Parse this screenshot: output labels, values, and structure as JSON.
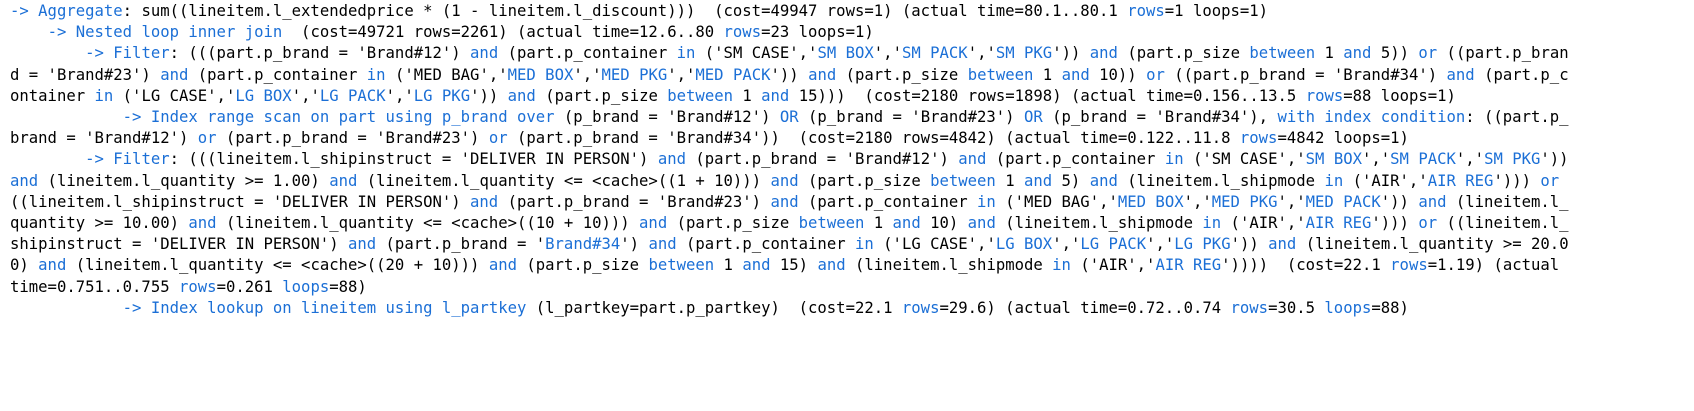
{
  "explain_output": {
    "colors": {
      "keyword": "#1b6fd6",
      "text": "#000000",
      "background": "#ffffff"
    },
    "lines": [
      {
        "indent": "",
        "segments": [
          {
            "t": "-> Aggregate",
            "k": 1
          },
          {
            "t": ": sum((lineitem.l_extendedprice * (1 - lineitem.l_discount)))  (cost=49947 rows=1) (actual time=80.1..80.1 ",
            "k": 0
          },
          {
            "t": "rows",
            "k": 1
          },
          {
            "t": "=1 loops=1)",
            "k": 0
          }
        ]
      },
      {
        "indent": "    ",
        "segments": [
          {
            "t": "-> Nested loop inner join",
            "k": 1
          },
          {
            "t": "  (cost=49721 rows=2261) (actual time=12.6..80 ",
            "k": 0
          },
          {
            "t": "rows",
            "k": 1
          },
          {
            "t": "=23 loops=1)",
            "k": 0
          }
        ]
      },
      {
        "indent": "        ",
        "segments": [
          {
            "t": "-> Filter",
            "k": 1
          },
          {
            "t": ": (((part.p_brand = 'Brand#12') ",
            "k": 0
          },
          {
            "t": "and",
            "k": 1
          },
          {
            "t": " (part.p_container ",
            "k": 0
          },
          {
            "t": "in",
            "k": 1
          },
          {
            "t": " ('SM CASE','",
            "k": 0
          },
          {
            "t": "SM BOX",
            "k": 1
          },
          {
            "t": "','",
            "k": 0
          },
          {
            "t": "SM PACK",
            "k": 1
          },
          {
            "t": "','",
            "k": 0
          },
          {
            "t": "SM PKG",
            "k": 1
          },
          {
            "t": "')) ",
            "k": 0
          },
          {
            "t": "and",
            "k": 1
          },
          {
            "t": " (part.p_size ",
            "k": 0
          },
          {
            "t": "between",
            "k": 1
          },
          {
            "t": " 1 ",
            "k": 0
          },
          {
            "t": "and",
            "k": 1
          },
          {
            "t": " 5)) ",
            "k": 0
          },
          {
            "t": "or",
            "k": 1
          },
          {
            "t": " ((part.p_brand = 'Brand#23') ",
            "k": 0
          },
          {
            "t": "and",
            "k": 1
          },
          {
            "t": " (part.p_container ",
            "k": 0
          },
          {
            "t": "in",
            "k": 1
          },
          {
            "t": " ('MED BAG','",
            "k": 0
          },
          {
            "t": "MED BOX",
            "k": 1
          },
          {
            "t": "','",
            "k": 0
          },
          {
            "t": "MED PKG",
            "k": 1
          },
          {
            "t": "','",
            "k": 0
          },
          {
            "t": "MED PACK",
            "k": 1
          },
          {
            "t": "')) ",
            "k": 0
          },
          {
            "t": "and",
            "k": 1
          },
          {
            "t": " (part.p_size ",
            "k": 0
          },
          {
            "t": "between",
            "k": 1
          },
          {
            "t": " 1 ",
            "k": 0
          },
          {
            "t": "and",
            "k": 1
          },
          {
            "t": " 10)) ",
            "k": 0
          },
          {
            "t": "or",
            "k": 1
          },
          {
            "t": " ((part.p_brand = 'Brand#34') ",
            "k": 0
          },
          {
            "t": "and",
            "k": 1
          },
          {
            "t": " (part.p_container ",
            "k": 0
          },
          {
            "t": "in",
            "k": 1
          },
          {
            "t": " ('LG CASE','",
            "k": 0
          },
          {
            "t": "LG BOX",
            "k": 1
          },
          {
            "t": "','",
            "k": 0
          },
          {
            "t": "LG PACK",
            "k": 1
          },
          {
            "t": "','",
            "k": 0
          },
          {
            "t": "LG PKG",
            "k": 1
          },
          {
            "t": "')) ",
            "k": 0
          },
          {
            "t": "and",
            "k": 1
          },
          {
            "t": " (part.p_size ",
            "k": 0
          },
          {
            "t": "between",
            "k": 1
          },
          {
            "t": " 1 ",
            "k": 0
          },
          {
            "t": "and",
            "k": 1
          },
          {
            "t": " 15)))  (cost=2180 rows=1898) (actual time=0.156..13.5 ",
            "k": 0
          },
          {
            "t": "rows",
            "k": 1
          },
          {
            "t": "=88 loops=1)",
            "k": 0
          }
        ]
      },
      {
        "indent": "            ",
        "segments": [
          {
            "t": "-> Index range scan on part using p_brand over",
            "k": 1
          },
          {
            "t": " (p_brand = 'Brand#12') ",
            "k": 0
          },
          {
            "t": "OR",
            "k": 1
          },
          {
            "t": " (p_brand = 'Brand#23') ",
            "k": 0
          },
          {
            "t": "OR",
            "k": 1
          },
          {
            "t": " (p_brand = 'Brand#34'), ",
            "k": 0
          },
          {
            "t": "with index condition",
            "k": 1
          },
          {
            "t": ": ((part.p_brand = 'Brand#12') ",
            "k": 0
          },
          {
            "t": "or",
            "k": 1
          },
          {
            "t": " (part.p_brand = 'Brand#23') ",
            "k": 0
          },
          {
            "t": "or",
            "k": 1
          },
          {
            "t": " (part.p_brand = 'Brand#34'))  (cost=2180 rows=4842) (actual time=0.122..11.8 ",
            "k": 0
          },
          {
            "t": "rows",
            "k": 1
          },
          {
            "t": "=4842 loops=1)",
            "k": 0
          }
        ]
      },
      {
        "indent": "        ",
        "segments": [
          {
            "t": "-> Filter",
            "k": 1
          },
          {
            "t": ": (((lineitem.l_shipinstruct = 'DELIVER IN PERSON') ",
            "k": 0
          },
          {
            "t": "and",
            "k": 1
          },
          {
            "t": " (part.p_brand = 'Brand#12') ",
            "k": 0
          },
          {
            "t": "and",
            "k": 1
          },
          {
            "t": " (part.p_container ",
            "k": 0
          },
          {
            "t": "in",
            "k": 1
          },
          {
            "t": " ('SM CASE','",
            "k": 0
          },
          {
            "t": "SM BOX",
            "k": 1
          },
          {
            "t": "','",
            "k": 0
          },
          {
            "t": "SM PACK",
            "k": 1
          },
          {
            "t": "','",
            "k": 0
          },
          {
            "t": "SM PKG",
            "k": 1
          },
          {
            "t": "')) ",
            "k": 0
          },
          {
            "t": "and",
            "k": 1
          },
          {
            "t": " (lineitem.l_quantity >= 1.00) ",
            "k": 0
          },
          {
            "t": "and",
            "k": 1
          },
          {
            "t": " (lineitem.l_quantity <= <cache>((1 + 10))) ",
            "k": 0
          },
          {
            "t": "and",
            "k": 1
          },
          {
            "t": " (part.p_size ",
            "k": 0
          },
          {
            "t": "between",
            "k": 1
          },
          {
            "t": " 1 ",
            "k": 0
          },
          {
            "t": "and",
            "k": 1
          },
          {
            "t": " 5) ",
            "k": 0
          },
          {
            "t": "and",
            "k": 1
          },
          {
            "t": " (lineitem.l_shipmode ",
            "k": 0
          },
          {
            "t": "in",
            "k": 1
          },
          {
            "t": " ('AIR','",
            "k": 0
          },
          {
            "t": "AIR REG",
            "k": 1
          },
          {
            "t": "'))) ",
            "k": 0
          },
          {
            "t": "or",
            "k": 1
          },
          {
            "t": " ((lineitem.l_shipinstruct = 'DELIVER IN PERSON') ",
            "k": 0
          },
          {
            "t": "and",
            "k": 1
          },
          {
            "t": " (part.p_brand = 'Brand#23') ",
            "k": 0
          },
          {
            "t": "and",
            "k": 1
          },
          {
            "t": " (part.p_container ",
            "k": 0
          },
          {
            "t": "in",
            "k": 1
          },
          {
            "t": " ('MED BAG','",
            "k": 0
          },
          {
            "t": "MED BOX",
            "k": 1
          },
          {
            "t": "','",
            "k": 0
          },
          {
            "t": "MED PKG",
            "k": 1
          },
          {
            "t": "','",
            "k": 0
          },
          {
            "t": "MED PACK",
            "k": 1
          },
          {
            "t": "')) ",
            "k": 0
          },
          {
            "t": "and",
            "k": 1
          },
          {
            "t": " (lineitem.l_quantity >= 10.00) ",
            "k": 0
          },
          {
            "t": "and",
            "k": 1
          },
          {
            "t": " (lineitem.l_quantity <= <cache>((10 + 10))) ",
            "k": 0
          },
          {
            "t": "and",
            "k": 1
          },
          {
            "t": " (part.p_size ",
            "k": 0
          },
          {
            "t": "between",
            "k": 1
          },
          {
            "t": " 1 ",
            "k": 0
          },
          {
            "t": "and",
            "k": 1
          },
          {
            "t": " 10) ",
            "k": 0
          },
          {
            "t": "and",
            "k": 1
          },
          {
            "t": " (lineitem.l_shipmode ",
            "k": 0
          },
          {
            "t": "in",
            "k": 1
          },
          {
            "t": " ('AIR','",
            "k": 0
          },
          {
            "t": "AIR REG",
            "k": 1
          },
          {
            "t": "'))) ",
            "k": 0
          },
          {
            "t": "or",
            "k": 1
          },
          {
            "t": " ((lineitem.l_shipinstruct = 'DELIVER IN PERSON') ",
            "k": 0
          },
          {
            "t": "and",
            "k": 1
          },
          {
            "t": " (part.p_brand = '",
            "k": 0
          },
          {
            "t": "Brand#34",
            "k": 1
          },
          {
            "t": "') ",
            "k": 0
          },
          {
            "t": "and",
            "k": 1
          },
          {
            "t": " (part.p_container ",
            "k": 0
          },
          {
            "t": "in",
            "k": 1
          },
          {
            "t": " ('LG CASE','",
            "k": 0
          },
          {
            "t": "LG BOX",
            "k": 1
          },
          {
            "t": "','",
            "k": 0
          },
          {
            "t": "LG PACK",
            "k": 1
          },
          {
            "t": "','",
            "k": 0
          },
          {
            "t": "LG PKG",
            "k": 1
          },
          {
            "t": "')) ",
            "k": 0
          },
          {
            "t": "and",
            "k": 1
          },
          {
            "t": " (lineitem.l_quantity >= 20.00) ",
            "k": 0
          },
          {
            "t": "and",
            "k": 1
          },
          {
            "t": " (lineitem.l_quantity <= <cache>((20 + 10))) ",
            "k": 0
          },
          {
            "t": "and",
            "k": 1
          },
          {
            "t": " (part.p_size ",
            "k": 0
          },
          {
            "t": "between",
            "k": 1
          },
          {
            "t": " 1 ",
            "k": 0
          },
          {
            "t": "and",
            "k": 1
          },
          {
            "t": " 15) ",
            "k": 0
          },
          {
            "t": "and",
            "k": 1
          },
          {
            "t": " (lineitem.l_shipmode ",
            "k": 0
          },
          {
            "t": "in",
            "k": 1
          },
          {
            "t": " ('AIR','",
            "k": 0
          },
          {
            "t": "AIR REG",
            "k": 1
          },
          {
            "t": "'))))  (cost=22.1 ",
            "k": 0
          },
          {
            "t": "rows",
            "k": 1
          },
          {
            "t": "=1.19) (actual time=0.751..0.755 ",
            "k": 0
          },
          {
            "t": "rows",
            "k": 1
          },
          {
            "t": "=0.261 ",
            "k": 0
          },
          {
            "t": "loops",
            "k": 1
          },
          {
            "t": "=88)",
            "k": 0
          }
        ]
      },
      {
        "indent": "            ",
        "segments": [
          {
            "t": "-> Index lookup on lineitem using l_partkey",
            "k": 1
          },
          {
            "t": " (l_partkey=part.p_partkey)  (cost=22.1 ",
            "k": 0
          },
          {
            "t": "rows",
            "k": 1
          },
          {
            "t": "=29.6) (actual time=0.72..0.74 ",
            "k": 0
          },
          {
            "t": "rows",
            "k": 1
          },
          {
            "t": "=30.5 ",
            "k": 0
          },
          {
            "t": "loops",
            "k": 1
          },
          {
            "t": "=88)",
            "k": 0
          }
        ]
      }
    ]
  }
}
